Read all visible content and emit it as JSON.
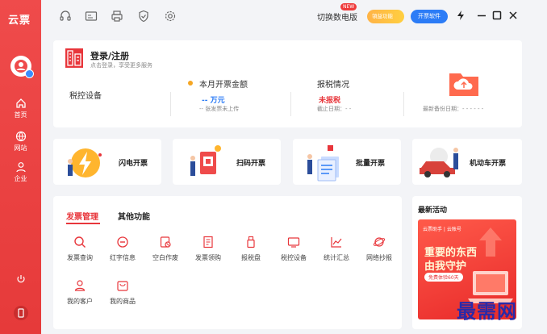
{
  "app": {
    "logo": "云票"
  },
  "sidebar": {
    "items": [
      {
        "label": "首页",
        "icon": "home-icon"
      },
      {
        "label": "网站",
        "icon": "globe-icon"
      },
      {
        "label": "企业",
        "icon": "user-icon"
      }
    ],
    "bottom_icons": [
      "power-icon",
      "phone-icon"
    ]
  },
  "topbar": {
    "icons": [
      "headset-icon",
      "id-card-icon",
      "printer-icon",
      "shield-icon",
      "gear-icon"
    ],
    "switch_label": "切换数电版",
    "new_badge": "NEW",
    "orange_button": "領益功能",
    "blue_button": "开票软件"
  },
  "device": {
    "title": "登录/注册",
    "subtitle": "点击登录，享受更多服务",
    "tax_device_label": "税控设备",
    "monthly_label": "本月开票金额",
    "monthly_value": "-- 万元",
    "monthly_sub": "-- 张发票未上传",
    "report_label": "报税情况",
    "report_value": "未报税",
    "report_sub": "截止日期：- -",
    "backup_label": "最新备份日期：- - - - - -"
  },
  "features": [
    {
      "label": "闪电开票"
    },
    {
      "label": "扫码开票"
    },
    {
      "label": "批量开票"
    },
    {
      "label": "机动车开票"
    }
  ],
  "tabs": {
    "active": "发票管理",
    "other": "其他功能"
  },
  "functions": [
    {
      "label": "发票查询",
      "icon": "search-icon"
    },
    {
      "label": "红字信息",
      "icon": "minus-circle-icon"
    },
    {
      "label": "空白作废",
      "icon": "void-icon"
    },
    {
      "label": "发票领购",
      "icon": "invoice-icon"
    },
    {
      "label": "报税盘",
      "icon": "usb-icon"
    },
    {
      "label": "税控设备",
      "icon": "monitor-icon"
    },
    {
      "label": "统计汇总",
      "icon": "chart-icon"
    },
    {
      "label": "网络抄报",
      "icon": "planet-icon"
    },
    {
      "label": "我的客户",
      "icon": "customer-icon"
    },
    {
      "label": "我的商品",
      "icon": "goods-icon"
    }
  ],
  "news": {
    "title": "最新活动",
    "banner_top": "云票助手  |  云账号",
    "banner_line1": "重要的东西",
    "banner_line2": "由我守护",
    "banner_button": "免费体验60天"
  },
  "watermark": "最需网",
  "colors": {
    "brand_red": "#e83c3c",
    "blue": "#2c7cf6",
    "orange": "#ffb347"
  }
}
